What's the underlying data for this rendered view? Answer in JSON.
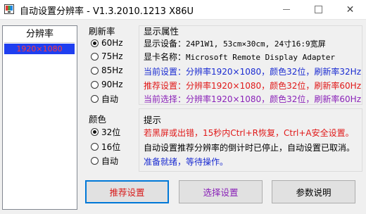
{
  "window": {
    "title": "自动设置分辨率 - V1.3.2010.1213 X86U",
    "controls": {
      "minimize": "—",
      "maximize": "☐",
      "close": "✕"
    }
  },
  "resolution_list": {
    "header": "分辨率",
    "items": [
      "1920×1080"
    ],
    "selected_index": 0
  },
  "refresh_rate": {
    "label": "刷新率",
    "options": [
      "60Hz",
      "75Hz",
      "85Hz",
      "90Hz",
      "自动"
    ],
    "selected": "60Hz"
  },
  "color": {
    "label": "颜色",
    "options": [
      "32位",
      "16位",
      "自动"
    ],
    "selected": "32位"
  },
  "display_props": {
    "label": "显示属性",
    "device_label": "显示设备：",
    "device_value": "24P1W1, 53cm×30cm, 24寸16:9宽屏",
    "adapter_label": "显卡名称：",
    "adapter_value": "Microsoft Remote Display Adapter",
    "current_settings": "当前设置：分辨率1920×1080，颜色32位，刷新率32Hz",
    "recommended_settings": "推荐设置：分辨率1920×1080，颜色32位，刷新率60Hz",
    "current_selection": "当前选择：分辨率1920×1080，颜色32位，刷新率60Hz"
  },
  "tips": {
    "label": "提示",
    "line1": "若黑屏或出错，15秒内Ctrl+R恢复，Ctrl+A安全设置。",
    "line2": "自动设置推荐分辨率的倒计时已停止，自动设置已取消。",
    "line3": "准备就绪，等待操作。"
  },
  "buttons": {
    "recommend": "推荐设置",
    "select": "选择设置",
    "help": "参数说明"
  },
  "colors": {
    "selection_bg": "#1f3ff0",
    "selection_text": "#ff3b3b",
    "blue_text": "#1a2bd1",
    "red_text": "#e01818",
    "purple_text": "#8a22b8"
  }
}
